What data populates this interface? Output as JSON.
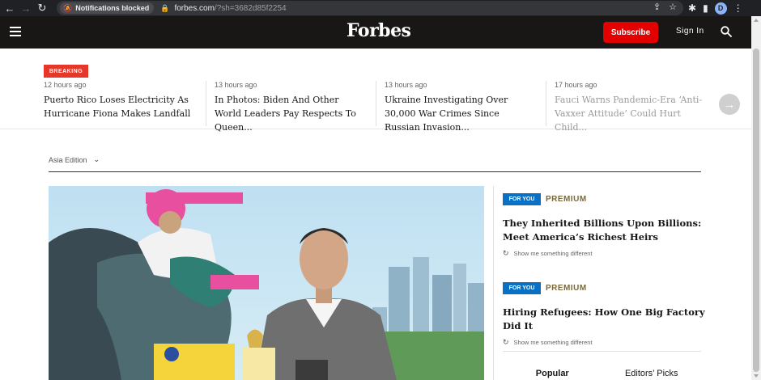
{
  "browser": {
    "notification_chip": "Notifications blocked",
    "url_host": "forbes.com",
    "url_rest": "/?sh=3682d85f2254",
    "profile_initial": "D"
  },
  "header": {
    "logo": "Forbes",
    "subscribe_label": "Subscribe",
    "signin_label": "Sign In"
  },
  "breaking": {
    "badge": "BREAKING",
    "stories": [
      {
        "time": "12 hours ago",
        "headline": "Puerto Rico Loses Electricity As Hurricane Fiona Makes Landfall"
      },
      {
        "time": "13 hours ago",
        "headline": "In Photos: Biden And Other World Leaders Pay Respects To Queen..."
      },
      {
        "time": "13 hours ago",
        "headline": "Ukraine Investigating Over 30,000 War Crimes Since Russian Invasion..."
      },
      {
        "time": "17 hours ago",
        "headline": "Fauci Warns Pandemic-Era ‘Anti-Vaxxer Attitude’ Could Hurt Child..."
      }
    ]
  },
  "edition": {
    "label": "Asia Edition"
  },
  "rail": {
    "items": [
      {
        "tag": "FOR YOU",
        "label": "PREMIUM",
        "headline": "They Inherited Billions Upon Billions: Meet America’s Richest Heirs",
        "show_me": "Show me something different"
      },
      {
        "tag": "FOR YOU",
        "label": "PREMIUM",
        "headline": "Hiring Refugees: How One Big Factory Did It",
        "show_me": "Show me something different"
      }
    ],
    "tabs": [
      {
        "label": "Popular"
      },
      {
        "label": "Editors’ Picks"
      }
    ]
  },
  "colors": {
    "header_bg": "#181716",
    "subscribe_red": "#e30000",
    "breaking_red": "#e6372a",
    "for_you_blue": "#0a70c6",
    "premium_gold": "#7a6a3a"
  }
}
